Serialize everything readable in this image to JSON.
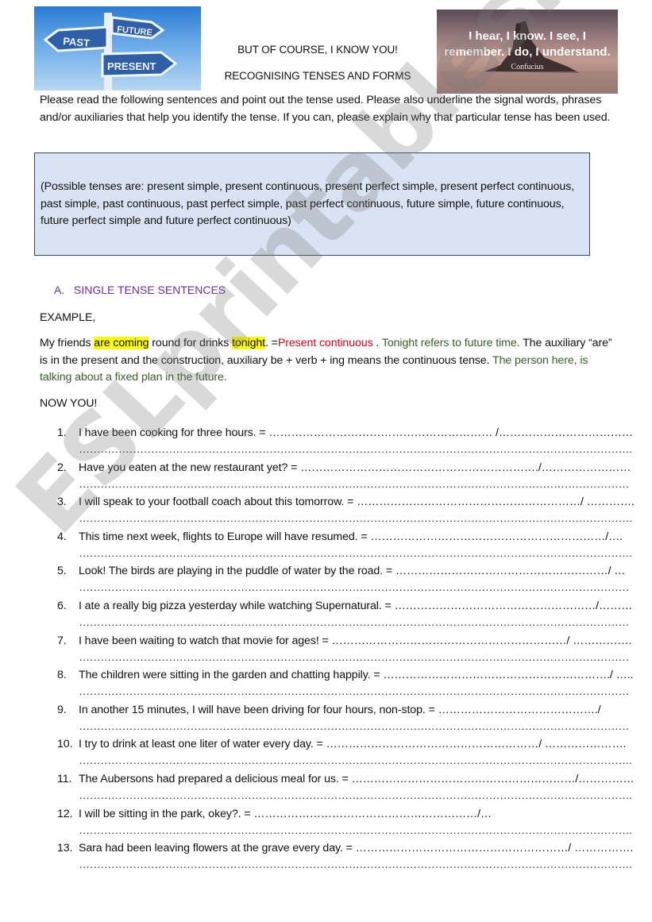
{
  "header": {
    "left_image": {
      "description": "signpost with past, present and future arrows",
      "signs": [
        "FUTURE",
        "PAST",
        "PRESENT"
      ]
    },
    "title_line1": "BUT OF COURSE, I KNOW YOU!",
    "title_line2": "RECOGNISING TENSES AND FORMS",
    "right_image": {
      "quote_line1": "I hear, I know. I see, I",
      "quote_line2": "remember. I do, I understand.",
      "author": "Confucius"
    }
  },
  "instructions": "Please read the following sentences and point out the tense used. Please also underline the signal words, phrases and/or auxiliaries that help you identify the tense. If you can, please explain why that particular tense has been used.",
  "tense_box": "(Possible tenses are: present simple, present continuous, present perfect simple, present perfect continuous, past simple, past continuous, past perfect simple, past perfect continuous, future simple, future continuous, future perfect simple and future perfect continuous)",
  "section": {
    "letter": "A.",
    "title": "SINGLE TENSE SENTENCES"
  },
  "example": {
    "label": "EXAMPLE,",
    "part1": "My friends ",
    "highlight1": "are coming",
    "part2": " round for drinks ",
    "highlight2": "tonight",
    "part3": ". =",
    "answer": "Present continuous",
    "part4": " .  ",
    "explain1": "Tonight refers to future time.",
    "explain2": " The auxiliary “are” is in the present and the construction, auxiliary be + verb + ing means the continuous tense. ",
    "explain3": "The person here,  is talking about a fixed plan in the future."
  },
  "now_you": "NOW YOU!",
  "questions": [
    {
      "num": "1.",
      "text": "I have been cooking for three hours. = …………………………………………………… /……………………………………",
      "answer_line": "………………………………………………………………………………………………………………………………………………………………………………………………."
    },
    {
      "num": "2.",
      "text": "Have you eaten at the new restaurant yet? = ………………………………………………………./…………………………………",
      "answer_line": "…………………………………………………………………………………………………………………………………………………………………………………………………"
    },
    {
      "num": "3.",
      "text": "I will speak to your football coach about this tomorrow. = ……………………………………………………/ ………….",
      "answer_line": "………………………………………………………………………………………………………………………………………………………………………………………………."
    },
    {
      "num": "4.",
      "text": "This time next week, flights to Europe will have resumed. = ………………………………………………………/….",
      "answer_line": "………………………………………………………………………………………………………………………………………………………………………………………………."
    },
    {
      "num": "5.",
      "text": "Look! The birds are playing in the puddle of water by the road. = …………………………………………………/ …",
      "answer_line": "…………………………………………………………………………………………………………………………………………………………………………………………………"
    },
    {
      "num": "6.",
      "text": "I ate a really big pizza yesterday while watching Supernatural. = ………………………………………………/………",
      "answer_line": "…………………………………………………………………………………………………………………………………………………………………………………………………"
    },
    {
      "num": "7.",
      "text": "I have been waiting to watch that movie for ages! = ………………………………………………………/ …………….",
      "answer_line": "…………………………………………………………………………………………………………………………………………………………………………………………………"
    },
    {
      "num": "8.",
      "text": "The children were sitting in the garden and chatting happily. = ……………………………………………………./ …..",
      "answer_line": "………………………………………………………………………………………………………………………………………………………………………………………………"
    },
    {
      "num": "9.",
      "text": "In another 15 minutes, I will have been driving for four hours, non-stop. = ……………………………………./",
      "answer_line": "………………………………………………………………………………………………………………………………………………………………………………………………"
    },
    {
      "num": "10.",
      "text": "I try to drink at least one liter of water every day. = …………………………………………………/ ………………….",
      "answer_line": "…………………………………………………………………………………………………………………………………………………………………………………………………."
    },
    {
      "num": "11.",
      "text": "The Aubersons had prepared a delicious meal for us. = ……………………………………………………/……………………",
      "answer_line": "…………………………………………………………………………………………………………………………………………………………………………………………………."
    },
    {
      "num": "12.",
      "text": "I will be sitting in the park, okey?. = ……………………………………………………/…",
      "answer_line": "………………………………………………………………………………………………………………………………………………………………………………………………."
    },
    {
      "num": "13.",
      "text": "Sara had been leaving flowers at the grave every day. = …………………………………………………/ …………….",
      "answer_line": "…………………………………………………………………………………………………………………………………………………………………………………………………."
    }
  ],
  "watermark": "ESLprintables.com",
  "colors": {
    "section_heading": "#7030a0",
    "highlight": "#ffff00",
    "answer_red": "#e0001a",
    "explain_green": "#38602a",
    "tense_box_bg": "#dae3f3"
  }
}
